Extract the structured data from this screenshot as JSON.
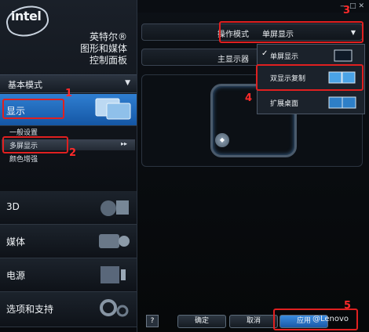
{
  "brand": {
    "logo": "intel",
    "title_lines": [
      "英特尔®",
      "图形和媒体",
      "控制面板"
    ]
  },
  "mode": {
    "label": "基本模式"
  },
  "categories": [
    {
      "label": "显示"
    },
    {
      "label": "3D"
    },
    {
      "label": "媒体"
    },
    {
      "label": "电源"
    },
    {
      "label": "选项和支持"
    }
  ],
  "subitems": {
    "general": "一般设置",
    "multi": "多屏显示",
    "color": "颜色增强",
    "ff": "▸▸"
  },
  "operation": {
    "label": "操作模式",
    "value": "单屏显示"
  },
  "main_display": {
    "label": "主显示器"
  },
  "menu": {
    "items": [
      {
        "label": "单屏显示",
        "checked": "✓"
      },
      {
        "label": "双显示复制",
        "checked": ""
      },
      {
        "label": "扩展桌面",
        "checked": ""
      }
    ]
  },
  "buttons": {
    "help": "?",
    "ok": "确定",
    "cancel": "取消",
    "apply": "应用"
  },
  "annotations": {
    "n1": "1",
    "n2": "2",
    "n3": "3",
    "n4": "4",
    "n5": "5"
  },
  "watermark": "@Lenovo",
  "colors": {
    "accent": "#2f7fd1",
    "annotation": "#e02020"
  }
}
